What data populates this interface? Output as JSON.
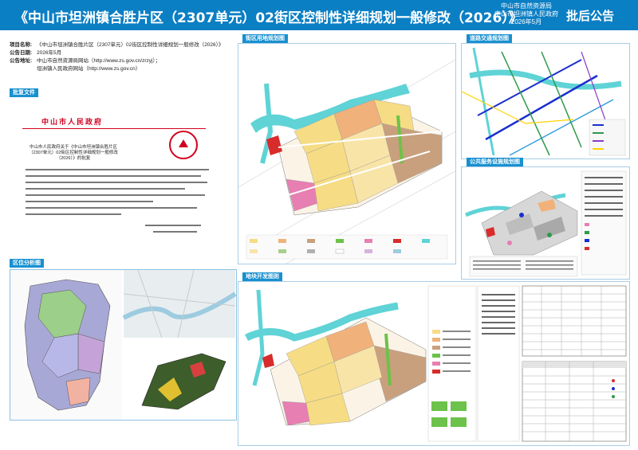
{
  "header": {
    "title": "《中山市坦洲镇合胜片区（2307单元）02街区控制性详细规划一般修改（2026）》",
    "issuer_line1": "中山市自然资源局",
    "issuer_line2": "中山市坦洲镇人民政府",
    "issuer_date": "2026年5月",
    "announce": "批后公告"
  },
  "info": {
    "project_name_key": "项目名称:",
    "project_name_val": "《中山市坦洲镇合胜片区（2307单元）02街区控制性详细规划一般修改（2026）》",
    "date_key": "公告日期:",
    "date_val": "2026年5月",
    "address_key": "公告地址:",
    "address_val1": "中山市自然资源局网站（http://www.zs.gov.cn/zrzyj）；",
    "address_val2": "坦洲镇人民政府网站（http://www.zs.gov.cn）"
  },
  "sections": {
    "approval": "批复文件",
    "location": "区位分析图",
    "landuse": "街区用地规划图",
    "traffic": "道路交通规划图",
    "facility": "公共服务设施规划图",
    "plot": "地块开发图则"
  },
  "approval_doc": {
    "letterhead": "中山市人民政府",
    "subject": "中山市人民政府关于《中山市坦洲镇合胜片区（2307单元）02街区控制性详细规划一般修改（2026）》的批复"
  },
  "colors": {
    "header": "#0b7fc4",
    "section": "#1890d0",
    "river": "#5fd3d6",
    "residential": "#f6dc84",
    "commercial": "#f0b27a",
    "industrial": "#c9a07d",
    "green": "#6cc24a",
    "public": "#e77fb2",
    "red": "#d2001e"
  }
}
